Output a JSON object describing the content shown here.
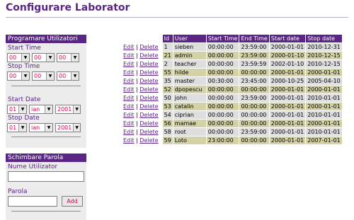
{
  "page": {
    "title": "Configurare Laborator"
  },
  "programare": {
    "title": "Programare Utilizatori",
    "start_time_label": "Start Time",
    "stop_time_label": "Stop Time",
    "start_time": [
      "00",
      "00",
      "00"
    ],
    "stop_time": [
      "00",
      "00",
      "00"
    ],
    "start_date_label": "Start Date",
    "stop_date_label": "Stop Date",
    "start_date": [
      "01",
      "ian",
      "2001"
    ],
    "stop_date": [
      "01",
      "ian",
      "2001"
    ]
  },
  "parola": {
    "title": "Schimbare Parola",
    "user_label": "Nume Utilizator",
    "user_value": "",
    "pass_label": "Parola",
    "pass_value": "",
    "add_label": "Add"
  },
  "table": {
    "edit_label": "Edit",
    "delete_label": "Delete",
    "separator": "|",
    "columns": [
      "Id",
      "User",
      "Start Time",
      "End Time",
      "Start date",
      "Stop date"
    ],
    "rows": [
      [
        "1",
        "sieben",
        "00:00:00",
        "23:59:00",
        "2000-01-01",
        "2010-12-31"
      ],
      [
        "21",
        "admin",
        "00:00:00",
        "23:59:00",
        "2000-01-10",
        "2010-12-15"
      ],
      [
        "2",
        "teacher",
        "00:00:00",
        "23:59:59",
        "2002-01-10",
        "2010-12-15"
      ],
      [
        "55",
        "hilde",
        "00:00:00",
        "00:00:00",
        "2000-01-01",
        "2000-01-01"
      ],
      [
        "35",
        "master",
        "00:30:00",
        "23:45:00",
        "2000-10-25",
        "2005-04-10"
      ],
      [
        "52",
        "dpopescu",
        "00:00:00",
        "00:00:00",
        "2000-01-01",
        "2000-01-01"
      ],
      [
        "50",
        "john",
        "00:00:00",
        "23:59:00",
        "2000-01-01",
        "2010-01-01"
      ],
      [
        "53",
        "catalin",
        "00:00:00",
        "00:00:00",
        "2000-01-01",
        "2000-01-01"
      ],
      [
        "54",
        "ciprian",
        "00:00:00",
        "00:00:00",
        "2000-01-01",
        "2010-01-01"
      ],
      [
        "56",
        "mamae",
        "00:00:00",
        "00:00:00",
        "2000-01-01",
        "2000-01-01"
      ],
      [
        "58",
        "root",
        "00:00:00",
        "23:59:00",
        "2000-01-01",
        "2010-01-01"
      ],
      [
        "59",
        "Loto",
        "23:00:00",
        "00:00:00",
        "2000-01-01",
        "2007-01-01"
      ]
    ]
  }
}
